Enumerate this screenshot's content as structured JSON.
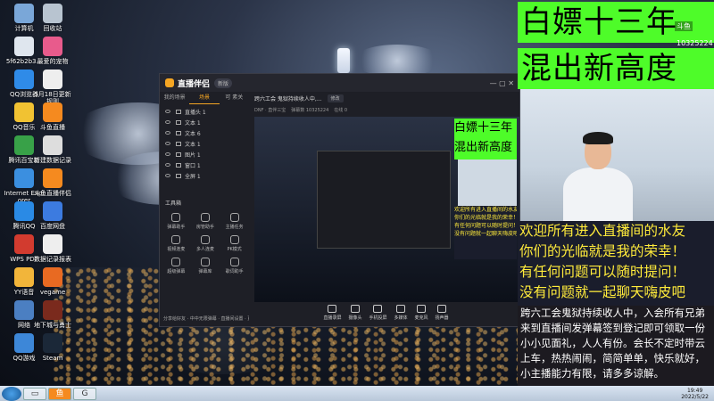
{
  "desktop": {
    "icons": [
      {
        "label": "计算机",
        "icon": "computer-icon",
        "color": "#7aa7d8"
      },
      {
        "label": "回收站",
        "icon": "recycle-bin-icon",
        "color": "#b8c4d0"
      },
      {
        "label": "5f62b2b3...",
        "icon": "file-icon",
        "color": "#dfe6ee"
      },
      {
        "label": "最爱的宠物",
        "icon": "app-icon",
        "color": "#e85b8c"
      },
      {
        "label": "QQ浏览器",
        "icon": "browser-icon",
        "color": "#2f8be8"
      },
      {
        "label": "5月18日更新规则",
        "icon": "document-icon",
        "color": "#eeeeee"
      },
      {
        "label": "QQ音乐",
        "icon": "music-icon",
        "color": "#f1c232"
      },
      {
        "label": "斗鱼直播",
        "icon": "douyu-icon",
        "color": "#f58a1f"
      },
      {
        "label": "腾讯百宝箱",
        "icon": "toolbox-icon",
        "color": "#38a148"
      },
      {
        "label": "新建数据记录",
        "icon": "document-icon",
        "color": "#dddddd"
      },
      {
        "label": "Internet Explorer",
        "icon": "ie-icon",
        "color": "#3b8fe0"
      },
      {
        "label": "斗鱼直播伴侣",
        "icon": "douyu-icon",
        "color": "#f58a1f"
      },
      {
        "label": "腾讯QQ",
        "icon": "qq-icon",
        "color": "#2a8ae5"
      },
      {
        "label": "百度网盘",
        "icon": "cloud-drive-icon",
        "color": "#3c7be0"
      },
      {
        "label": "WPS PDF",
        "icon": "pdf-icon",
        "color": "#d23b2f"
      },
      {
        "label": "数据记录报表",
        "icon": "spreadsheet-icon",
        "color": "#eeeeee"
      },
      {
        "label": "YY语音",
        "icon": "yy-icon",
        "color": "#f2b53a"
      },
      {
        "label": "vegame",
        "icon": "game-icon",
        "color": "#e86a22"
      },
      {
        "label": "网络",
        "icon": "network-icon",
        "color": "#4b7fc2"
      },
      {
        "label": "地下城与勇士",
        "icon": "game-icon",
        "color": "#7a2a1d"
      },
      {
        "label": "QQ游戏",
        "icon": "qq-game-icon",
        "color": "#3d87d8"
      },
      {
        "label": "Steam",
        "icon": "steam-icon",
        "color": "#1b2838"
      }
    ]
  },
  "app": {
    "logo": "直播伴侣",
    "badge": "新版",
    "tabs": [
      "我的场景",
      "场景",
      "可 素关"
    ],
    "sources": [
      "直播头 1",
      "文本 1",
      "文本 6",
      "文本 1",
      "图片 1",
      "窗口 1",
      "全屏 1"
    ],
    "tools_title": "工具箱",
    "tools": [
      "弹幕助手",
      "房管助手",
      "主播任务",
      "视频连麦",
      "多人连麦",
      "PK模式",
      "超级弹幕",
      "弹幕库",
      "歌词助手"
    ],
    "status": "分享给好友 · 中中无限弹幕 · 直播间设置 · 更上一层楼",
    "room_title": "跨六工会 鬼狱持续收人中,...",
    "room_tag": "修改",
    "sub_info": [
      "DNF · 直伴三宝",
      "弹幕数 10325224",
      "在线 0"
    ],
    "bottom_buttons": [
      "直播录屏",
      "摄像头",
      "手机投屏",
      "多媒体",
      "麦克风",
      "扬声器"
    ]
  },
  "stream": {
    "title_line1": "白嫖十三年",
    "title_line2": "混出新高度",
    "live_logo": "斗鱼",
    "room_id": "10325224",
    "welcome_lines": [
      "欢迎所有进入直播间的水友",
      "你们的光临就是我的荣幸！",
      "有任何问题可以随时提问！",
      "没有问题就一起聊天嗨皮吧"
    ],
    "notice": "跨六工会鬼狱持续收人中，入会所有兄弟来到直播间发弹幕签到登记即可领取一份小小见面礼，人人有份。会长不定时带云上车，热热闹闹，简简单单，快乐就好，小主播能力有限，请多多谅解。"
  },
  "taskbar": {
    "apps": [
      "windows-explorer-icon",
      "douyu-icon",
      "game-icon"
    ],
    "time": "19:49",
    "date": "2022/5/22"
  },
  "colors": {
    "title_bg": "#4efc29",
    "welcome_text": "#ffeb3b",
    "app_accent": "#f5a623"
  }
}
